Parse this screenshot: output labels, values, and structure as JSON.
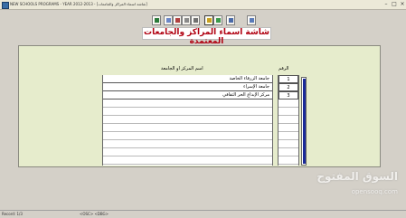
{
  "window": {
    "title": "NEW SCHOOLS PROGRAMS - YEAR 2012-2013 - [شاشة اسماء المراكز والجامعات]"
  },
  "toolbar": {
    "buttons": [
      {
        "icon": "exit-door-icon"
      },
      {
        "icon": "new-record-icon"
      },
      {
        "icon": "delete-record-icon"
      },
      {
        "icon": "query-icon"
      },
      {
        "icon": "execute-query-icon"
      },
      {
        "icon": "save-icon"
      },
      {
        "icon": "print-icon"
      },
      {
        "icon": "first-record-icon"
      },
      {
        "icon": "copy-icon"
      }
    ]
  },
  "form": {
    "title": "شاشة اسماء المراكز والجامعات المعتمدة",
    "col_name_header": "اسم المركز او الجامعة",
    "col_number_header": "الرقم",
    "rows": [
      {
        "number": "1",
        "name": "جامعة الزرقاء الخاصة"
      },
      {
        "number": "2",
        "name": "جامعة الإسراء"
      },
      {
        "number": "3",
        "name": "مركز الإبداع الحر الثقافي"
      }
    ],
    "empty_rows": 8
  },
  "statusbar": {
    "record": "Record: 1/3",
    "mode": "<OSC> <DBG>"
  },
  "watermark": {
    "arabic": "السوق المفتوح",
    "english": "opensooq.com"
  },
  "colors": {
    "title_red": "#b00010",
    "panel_bg": "#e6eccc",
    "scroll_thumb": "#1a2a9a"
  }
}
